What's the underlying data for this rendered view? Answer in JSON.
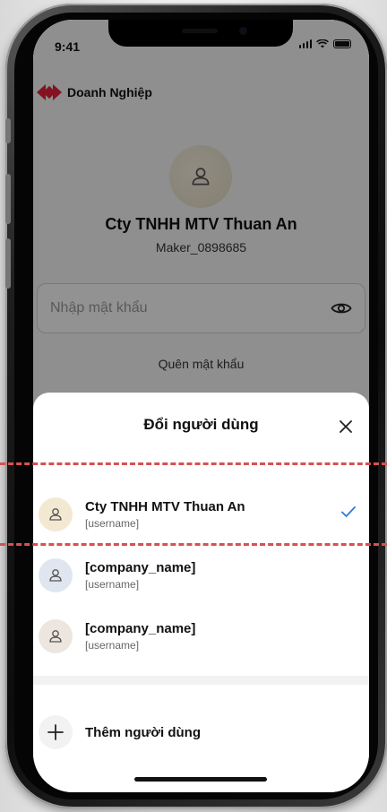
{
  "status_bar": {
    "time": "9:41"
  },
  "brand": {
    "name": "Doanh Nghiệp"
  },
  "login": {
    "company_name": "Cty TNHH MTV Thuan An",
    "username": "Maker_0898685",
    "password_placeholder": "Nhập mật khẩu",
    "forgot_password": "Quên mật khẩu"
  },
  "sheet": {
    "title": "Đổi người dùng",
    "accounts": [
      {
        "name": "Cty TNHH MTV Thuan An",
        "username": "[username]",
        "selected": true
      },
      {
        "name": "[company_name]",
        "username": "[username]",
        "selected": false
      },
      {
        "name": "[company_name]",
        "username": "[username]",
        "selected": false
      }
    ],
    "add_user": "Thêm người dùng"
  },
  "colors": {
    "brand_red": "#e3203a",
    "check_blue": "#2f7ad8",
    "dashed_highlight": "#d65252"
  }
}
